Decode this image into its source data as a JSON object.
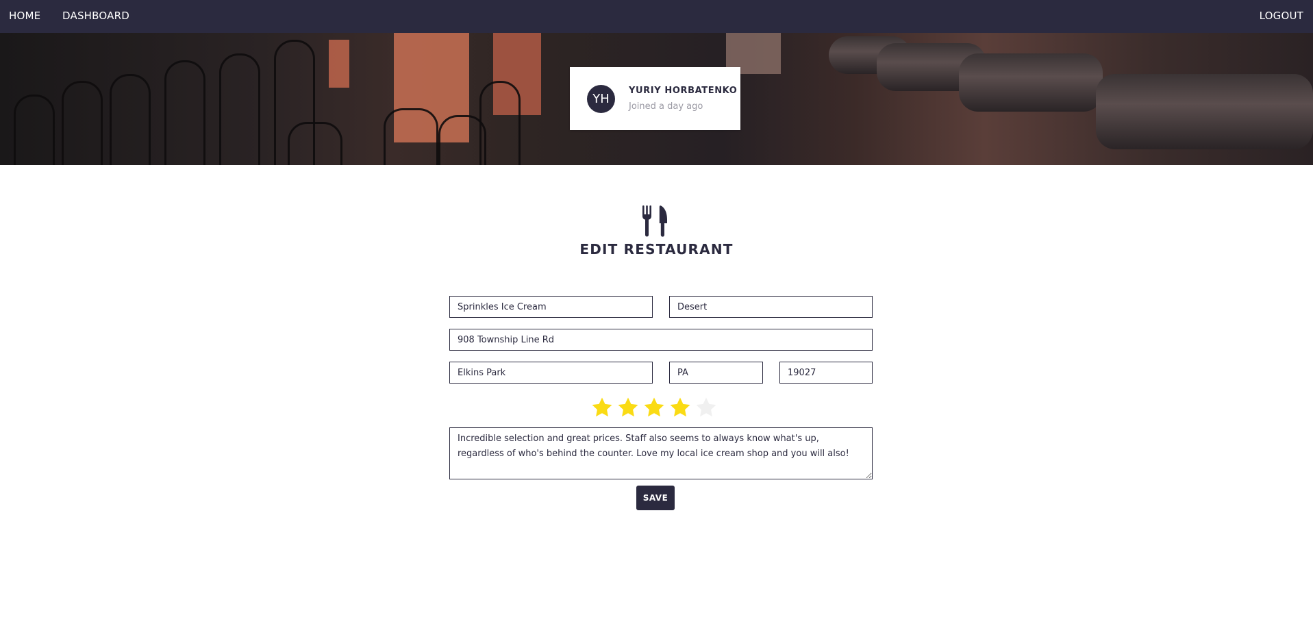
{
  "nav": {
    "home": "HOME",
    "dashboard": "DASHBOARD",
    "logout": "LOGOUT"
  },
  "profile": {
    "initials": "YH",
    "name": "YURIY HORBATENKO",
    "joined": "Joined a day ago"
  },
  "page": {
    "icon": "utensils-icon",
    "title": "EDIT RESTAURANT"
  },
  "form": {
    "name": "Sprinkles Ice Cream",
    "category": "Desert",
    "address": "908 Township Line Rd",
    "city": "Elkins Park",
    "state": "PA",
    "zip": "19027",
    "rating": 4,
    "rating_max": 5,
    "review": "Incredible selection and great prices. Staff also seems to always know what's up, regardless of who's behind the counter. Love my local ice cream shop and you will also!",
    "save_label": "SAVE"
  },
  "colors": {
    "brand": "#2b2a3f",
    "star_filled": "#fadb14",
    "star_empty": "#f0f0f0"
  }
}
